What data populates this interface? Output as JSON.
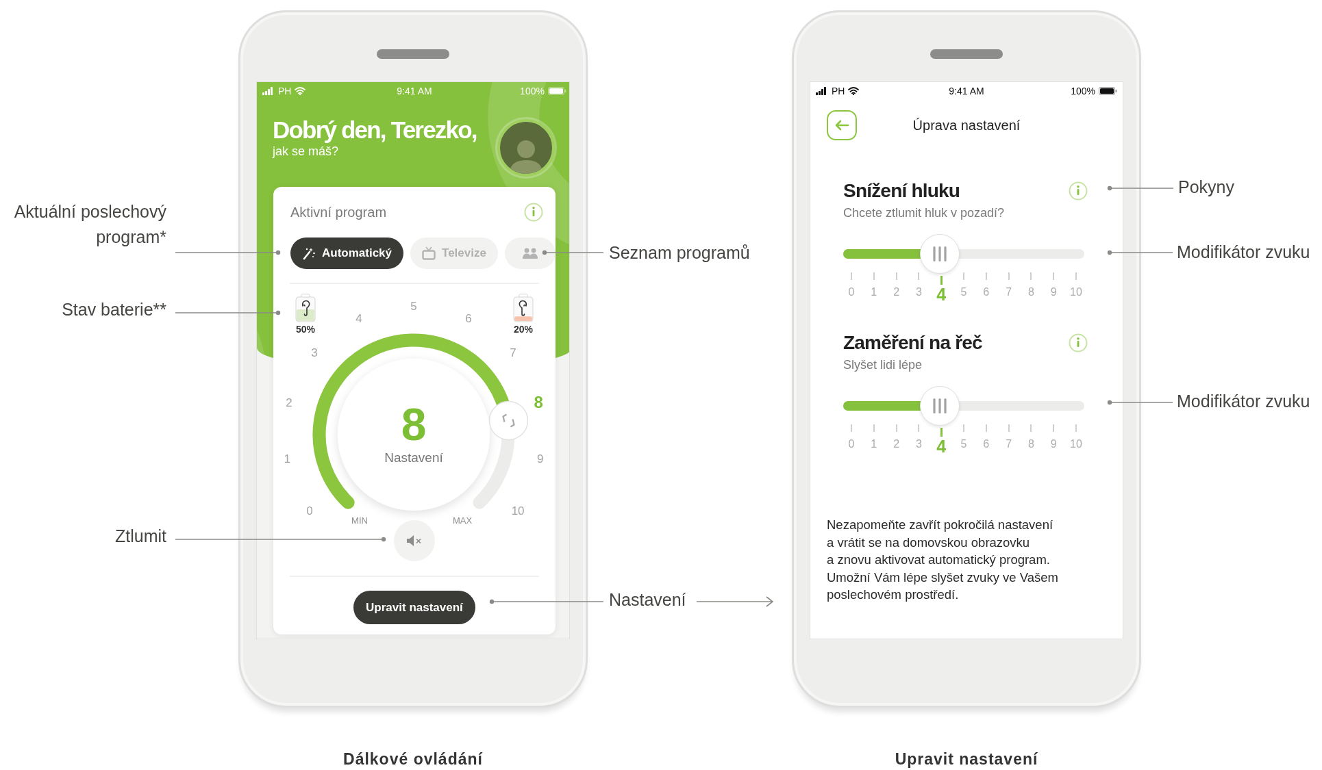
{
  "remote_screen": {
    "caption": "Dálkové ovládání",
    "status_bar": {
      "carrier": "PH",
      "time": "9:41 AM",
      "battery": "100%"
    },
    "greeting": "Dobrý den, Terezko,",
    "subtitle": "jak se máš?",
    "program_card": {
      "title": "Aktivní program",
      "programs": [
        {
          "kind": "automatic",
          "label": "Automatický",
          "selected": true
        },
        {
          "kind": "tv",
          "label": "Televize",
          "selected": false
        },
        {
          "kind": "group",
          "selected": false
        }
      ]
    },
    "batteries": [
      {
        "kind": "left",
        "reading": "50%",
        "level": 0.5,
        "color": "#dcebc9"
      },
      {
        "kind": "right",
        "reading": "20%",
        "level": 0.2,
        "color": "#f8c3ad"
      }
    ],
    "dial": {
      "value": "8",
      "label": "Nastavení",
      "min_label": "MIN",
      "max_label": "MAX",
      "ticks": [
        {
          "label": "0",
          "selected": false
        },
        {
          "label": "1",
          "selected": false
        },
        {
          "label": "2",
          "selected": false
        },
        {
          "label": "3",
          "selected": false
        },
        {
          "label": "4",
          "selected": false
        },
        {
          "label": "5",
          "selected": false
        },
        {
          "label": "6",
          "selected": false
        },
        {
          "label": "7",
          "selected": false
        },
        {
          "label": "8",
          "selected": true
        },
        {
          "label": "9",
          "selected": false
        },
        {
          "label": "10",
          "selected": false
        }
      ]
    },
    "adjust_button": "Upravit nastavení"
  },
  "settings_screen": {
    "caption": "Upravit nastavení",
    "status_bar": {
      "carrier": "PH",
      "time": "9:41 AM",
      "battery": "100%"
    },
    "title": "Úprava nastavení",
    "modifiers": [
      {
        "title": "Snížení hluku",
        "subtitle": "Chcete ztlumit hluk v pozadí?",
        "level": 0.4,
        "scale": [
          {
            "label": "0",
            "selected": false
          },
          {
            "label": "1",
            "selected": false
          },
          {
            "label": "2",
            "selected": false
          },
          {
            "label": "3",
            "selected": false
          },
          {
            "label": "4",
            "selected": true
          },
          {
            "label": "5",
            "selected": false
          },
          {
            "label": "6",
            "selected": false
          },
          {
            "label": "7",
            "selected": false
          },
          {
            "label": "8",
            "selected": false
          },
          {
            "label": "9",
            "selected": false
          },
          {
            "label": "10",
            "selected": false
          }
        ]
      },
      {
        "title": "Zaměření na řeč",
        "subtitle": "Slyšet lidi lépe",
        "level": 0.4,
        "scale": [
          {
            "label": "0",
            "selected": false
          },
          {
            "label": "1",
            "selected": false
          },
          {
            "label": "2",
            "selected": false
          },
          {
            "label": "3",
            "selected": false
          },
          {
            "label": "4",
            "selected": true
          },
          {
            "label": "5",
            "selected": false
          },
          {
            "label": "6",
            "selected": false
          },
          {
            "label": "7",
            "selected": false
          },
          {
            "label": "8",
            "selected": false
          },
          {
            "label": "9",
            "selected": false
          },
          {
            "label": "10",
            "selected": false
          }
        ]
      }
    ],
    "note": "Nezapomeňte zavřít pokročilá nastavení\na vrátit se na domovskou obrazovku\na znovu aktivovat automatický program.\nUmožní Vám lépe slyšet zvuky ve Vašem\nposlechovém prostředí."
  },
  "annotations": [
    {
      "kind": "plain",
      "text": "Aktuální poslechový\nprogram*"
    },
    {
      "kind": "plain",
      "text": "Stav baterie**"
    },
    {
      "kind": "plain",
      "text": "Ztlumit"
    },
    {
      "kind": "plain",
      "text": "Seznam programů"
    },
    {
      "kind": "arrow",
      "text": "Nastavení"
    },
    {
      "kind": "plain",
      "text": "Pokyny"
    },
    {
      "kind": "plain",
      "text": "Modifikátor zvuku"
    },
    {
      "kind": "plain",
      "text": "Modifikátor zvuku"
    }
  ]
}
